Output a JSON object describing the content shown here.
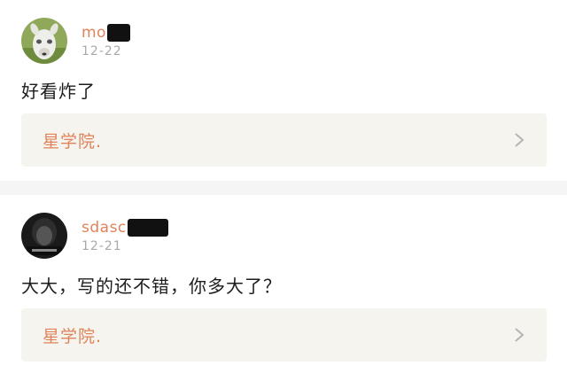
{
  "colors": {
    "username": "#e0835a",
    "date": "#a9a9a9",
    "card_bg": "#f5f4ee",
    "separator": "#f5f5f5"
  },
  "comments": [
    {
      "username": "mo",
      "date": "12-22",
      "text": "好看炸了",
      "card": {
        "title": "星学院.",
        "icon": "chevron-right-icon"
      },
      "avatar_icon": "alpaca-avatar"
    },
    {
      "username": "sdasc",
      "date": "12-21",
      "text": "大大，写的还不错，你多大了？",
      "card": {
        "title": "星学院.",
        "icon": "chevron-right-icon"
      },
      "avatar_icon": "dark-portrait-avatar"
    }
  ]
}
